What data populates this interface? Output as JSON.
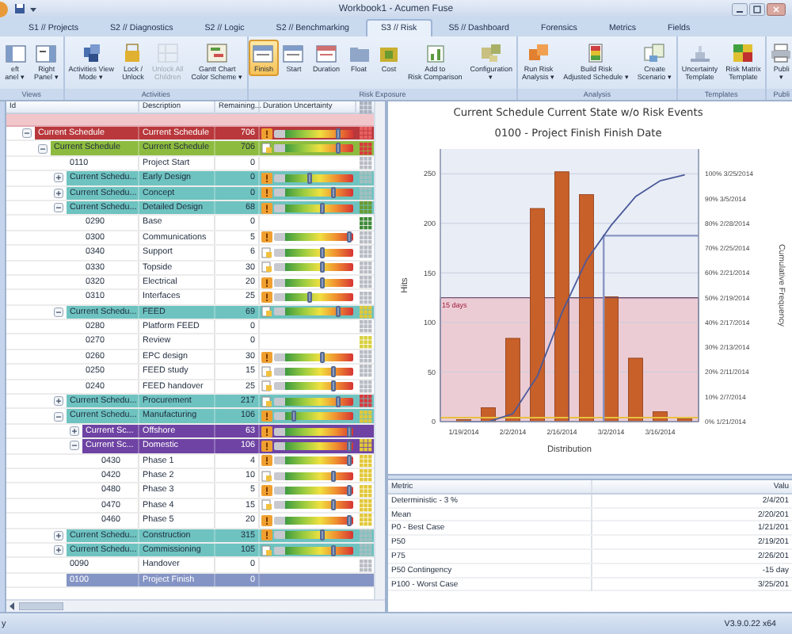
{
  "window": {
    "title": "Workbook1 - Acumen Fuse"
  },
  "tabs": [
    {
      "label": "S1 // Projects",
      "selected": false
    },
    {
      "label": "S2 // Diagnostics",
      "selected": false
    },
    {
      "label": "S2 // Logic",
      "selected": false
    },
    {
      "label": "S2 // Benchmarking",
      "selected": false
    },
    {
      "label": "S3 // Risk",
      "selected": true
    },
    {
      "label": "S5 // Dashboard",
      "selected": false
    },
    {
      "label": "Forensics",
      "selected": false
    },
    {
      "label": "Metrics",
      "selected": false
    },
    {
      "label": "Fields",
      "selected": false
    }
  ],
  "ribbon": {
    "groups": [
      {
        "label": "Views",
        "buttons": [
          {
            "label": "eft\nanel ▾"
          },
          {
            "label": "Right\nPanel ▾"
          }
        ]
      },
      {
        "label": "Activities",
        "buttons": [
          {
            "label": "Activities View\nMode ▾",
            "disabled": false
          },
          {
            "label": "Lock /\nUnlock",
            "disabled": false
          },
          {
            "label": "Unlock All\nChildren",
            "disabled": true
          },
          {
            "label": "Gantt Chart\nColor Scheme ▾",
            "disabled": false
          }
        ]
      },
      {
        "label": "Risk Exposure",
        "buttons": [
          {
            "label": "Finish",
            "selected": true
          },
          {
            "label": "Start",
            "selected": false
          },
          {
            "label": "Duration",
            "selected": false
          },
          {
            "label": "Float",
            "selected": false
          },
          {
            "label": "Cost",
            "selected": false
          },
          {
            "label": "Add to\nRisk Comparison"
          },
          {
            "label": "Configuration\n▾"
          }
        ]
      },
      {
        "label": "Analysis",
        "buttons": [
          {
            "label": "Run Risk\nAnalysis ▾"
          },
          {
            "label": "Build Risk\nAdjusted Schedule ▾"
          },
          {
            "label": "Create\nScenario ▾"
          }
        ]
      },
      {
        "label": "Templates",
        "buttons": [
          {
            "label": "Uncertainty\nTemplate"
          },
          {
            "label": "Risk Matrix\nTemplate"
          }
        ]
      },
      {
        "label": "Publi",
        "buttons": [
          {
            "label": "Publi\n▾"
          }
        ]
      }
    ]
  },
  "tree": {
    "columns": [
      "Id",
      "Description",
      "Remaining...",
      "Duration Uncertainty"
    ],
    "rows": [
      {
        "id": "Current Schedule",
        "description": "Current Schedule",
        "remaining": "706",
        "color": "#b8383c",
        "selected": false,
        "expanded": true,
        "risk_icon": {
          "kind": "alert"
        },
        "level": 0.8,
        "matrix": {
          "color": "#e86060"
        },
        "children": [
          {
            "id": "Current Schedule",
            "description": "Current Schedule",
            "remaining": "706",
            "color": "#8dbb3f",
            "selected": false,
            "expanded": true,
            "risk_icon": {
              "kind": "note"
            },
            "level": 0.8,
            "matrix": {
              "color": "#d9393e"
            },
            "children": [
              {
                "id": "0110",
                "description": "Project Start",
                "remaining": "0",
                "selected": false,
                "matrix": {
                  "color": "#b8bcc4"
                }
              },
              {
                "id": "Current Schedu...",
                "description": "Early Design",
                "remaining": "0",
                "color": "#6ec3c0",
                "selected": false,
                "expanded": false,
                "risk_icon": {
                  "kind": "alert"
                },
                "level": 0.45,
                "matrix": {
                  "color": "#a3bfc0"
                }
              },
              {
                "id": "Current Schedu...",
                "description": "Concept",
                "remaining": "0",
                "color": "#6ec3c0",
                "selected": false,
                "expanded": false,
                "risk_icon": {
                  "kind": "alert"
                },
                "level": 0.75,
                "matrix": {
                  "color": "#a3bfc0"
                }
              },
              {
                "id": "Current Schedu...",
                "description": "Detailed Design",
                "remaining": "68",
                "color": "#6ec3c0",
                "selected": false,
                "expanded": true,
                "risk_icon": {
                  "kind": "alert"
                },
                "level": 0.6,
                "matrix": {
                  "color": "#6a9a30"
                },
                "children": [
                  {
                    "id": "0290",
                    "description": "Base",
                    "remaining": "0",
                    "selected": false,
                    "matrix": {
                      "color": "#3f8a3a"
                    }
                  },
                  {
                    "id": "0300",
                    "description": "Communications",
                    "remaining": "5",
                    "selected": false,
                    "risk_icon": {
                      "kind": "alert"
                    },
                    "level": 0.95,
                    "matrix": {
                      "color": "#b8bcc4"
                    }
                  },
                  {
                    "id": "0340",
                    "description": "Support",
                    "remaining": "6",
                    "selected": false,
                    "risk_icon": {
                      "kind": "note"
                    },
                    "level": 0.6,
                    "matrix": {
                      "color": "#b8bcc4"
                    }
                  },
                  {
                    "id": "0330",
                    "description": "Topside",
                    "remaining": "30",
                    "selected": false,
                    "risk_icon": {
                      "kind": "note"
                    },
                    "level": 0.6,
                    "matrix": {
                      "color": "#b8bcc4"
                    }
                  },
                  {
                    "id": "0320",
                    "description": "Electrical",
                    "remaining": "20",
                    "selected": false,
                    "risk_icon": {
                      "kind": "alert"
                    },
                    "level": 0.6,
                    "matrix": {
                      "color": "#b8bcc4"
                    }
                  },
                  {
                    "id": "0310",
                    "description": "Interfaces",
                    "remaining": "25",
                    "selected": false,
                    "risk_icon": {
                      "kind": "alert"
                    },
                    "level": 0.45,
                    "matrix": {
                      "color": "#b8bcc4"
                    }
                  }
                ]
              },
              {
                "id": "Current Schedu...",
                "description": "FEED",
                "remaining": "69",
                "color": "#6ec3c0",
                "selected": false,
                "expanded": true,
                "risk_icon": {
                  "kind": "note"
                },
                "level": 0.8,
                "matrix": {
                  "color": "#e2c83a"
                },
                "children": [
                  {
                    "id": "0280",
                    "description": "Platform FEED",
                    "remaining": "0",
                    "selected": false,
                    "matrix": {
                      "color": "#b8bcc4"
                    }
                  },
                  {
                    "id": "0270",
                    "description": "Review",
                    "remaining": "0",
                    "selected": false,
                    "matrix": {
                      "color": "#d8d040"
                    }
                  },
                  {
                    "id": "0260",
                    "description": "EPC design",
                    "remaining": "30",
                    "selected": false,
                    "risk_icon": {
                      "kind": "alert"
                    },
                    "level": 0.6,
                    "matrix": {
                      "color": "#b8bcc4"
                    }
                  },
                  {
                    "id": "0250",
                    "description": "FEED study",
                    "remaining": "15",
                    "selected": false,
                    "risk_icon": {
                      "kind": "note"
                    },
                    "level": 0.75,
                    "matrix": {
                      "color": "#b8bcc4"
                    }
                  },
                  {
                    "id": "0240",
                    "description": "FEED handover",
                    "remaining": "25",
                    "selected": false,
                    "risk_icon": {
                      "kind": "note"
                    },
                    "level": 0.75,
                    "matrix": {
                      "color": "#b8bcc4"
                    }
                  }
                ]
              },
              {
                "id": "Current Schedu...",
                "description": "Procurement",
                "remaining": "217",
                "color": "#6ec3c0",
                "selected": false,
                "expanded": false,
                "risk_icon": {
                  "kind": "note"
                },
                "level": 0.8,
                "matrix": {
                  "color": "#d9393e"
                }
              },
              {
                "id": "Current Schedu...",
                "description": "Manufacturing",
                "remaining": "106",
                "color": "#6ec3c0",
                "selected": false,
                "expanded": true,
                "risk_icon": {
                  "kind": "alert"
                },
                "level": 0.25,
                "matrix": {
                  "color": "#e2c83a"
                },
                "children": [
                  {
                    "id": "Current Sc...",
                    "description": "Offshore",
                    "remaining": "63",
                    "color": "#6e43a3",
                    "selected": false,
                    "expanded": false,
                    "risk_icon": {
                      "kind": "alert"
                    },
                    "level": 0.95
                  },
                  {
                    "id": "Current Sc...",
                    "description": "Domestic",
                    "remaining": "106",
                    "color": "#6e43a3",
                    "selected": false,
                    "expanded": true,
                    "risk_icon": {
                      "kind": "alert"
                    },
                    "level": 0.95,
                    "matrix": {
                      "color": "#e2c83a"
                    },
                    "children": [
                      {
                        "id": "0430",
                        "description": "Phase 1",
                        "remaining": "4",
                        "selected": false,
                        "risk_icon": {
                          "kind": "alert"
                        },
                        "level": 0.95,
                        "matrix": {
                          "color": "#e2c83a"
                        }
                      },
                      {
                        "id": "0420",
                        "description": "Phase 2",
                        "remaining": "10",
                        "selected": false,
                        "risk_icon": {
                          "kind": "note"
                        },
                        "level": 0.75,
                        "matrix": {
                          "color": "#e2c83a"
                        }
                      },
                      {
                        "id": "0480",
                        "description": "Phase 3",
                        "remaining": "5",
                        "selected": false,
                        "risk_icon": {
                          "kind": "alert"
                        },
                        "level": 0.95,
                        "matrix": {
                          "color": "#e2c83a"
                        }
                      },
                      {
                        "id": "0470",
                        "description": "Phase 4",
                        "remaining": "15",
                        "selected": false,
                        "risk_icon": {
                          "kind": "note"
                        },
                        "level": 0.75,
                        "matrix": {
                          "color": "#e2c83a"
                        }
                      },
                      {
                        "id": "0460",
                        "description": "Phase 5",
                        "remaining": "20",
                        "selected": false,
                        "risk_icon": {
                          "kind": "alert"
                        },
                        "level": 0.95,
                        "matrix": {
                          "color": "#e2c83a"
                        }
                      }
                    ]
                  }
                ]
              },
              {
                "id": "Current Schedu...",
                "description": "Construction",
                "remaining": "315",
                "color": "#6ec3c0",
                "selected": false,
                "expanded": false,
                "risk_icon": {
                  "kind": "alert"
                },
                "level": 0.6,
                "matrix": {
                  "color": "#a3bfc0"
                }
              },
              {
                "id": "Current Schedu...",
                "description": "Commissioning",
                "remaining": "105",
                "color": "#6ec3c0",
                "selected": false,
                "expanded": false,
                "risk_icon": {
                  "kind": "note"
                },
                "level": 0.75,
                "matrix": {
                  "color": "#a3bfc0"
                }
              },
              {
                "id": "0090",
                "description": "Handover",
                "remaining": "0",
                "selected": false,
                "matrix": {
                  "color": "#b8bcc4"
                }
              },
              {
                "id": "0100",
                "description": "Project Finish",
                "remaining": "0",
                "selected": true
              }
            ]
          }
        ]
      }
    ]
  },
  "chart_panel": {
    "title": "Current Schedule Current State w/o Risk Events",
    "subtitle": "0100 - Project Finish Finish Date",
    "right_axis": {
      "labels": [
        "100% 3/25/2014",
        "90% 3/5/2014",
        "80% 2/28/2014",
        "70% 2/25/2014",
        "60% 2/21/2014",
        "50% 2/19/2014",
        "40% 2/17/2014",
        "30% 2/13/2014",
        "20% 2/11/2014",
        "10% 2/7/2014",
        "0% 1/21/2014"
      ]
    },
    "chart_data": {
      "type": "bar",
      "xlabel": "Distribution",
      "ylabel": "Hits",
      "categories": [
        "1/19/2014",
        null,
        "2/2/2014",
        null,
        "2/16/2014",
        null,
        "3/2/2014",
        null,
        "3/16/2014",
        null
      ],
      "series": [
        {
          "color": "#c8602a",
          "values": [
            2,
            14,
            84,
            215,
            252,
            229,
            126,
            64,
            10,
            3
          ]
        },
        {
          "name": "Cumulative Frequency",
          "type": "line",
          "color": "#4a5a9a",
          "values": [
            0,
            0,
            8,
            46,
            110,
            163,
            198,
            227,
            243,
            249
          ]
        }
      ],
      "bands": [
        {
          "axis": "y",
          "from": 0,
          "to": 125,
          "color": "#ecccd4"
        }
      ],
      "ylim": [
        0,
        275
      ],
      "yticks": [
        0,
        50,
        100,
        150,
        200,
        250
      ],
      "ref_lines": [
        {
          "axis": "y",
          "value": 125
        },
        {
          "axis": "y",
          "value": 187.5
        }
      ],
      "annotations": [
        {
          "text": "15 days"
        }
      ]
    }
  },
  "metrics": {
    "columns": [
      "Metric",
      "Valu"
    ],
    "rows": [
      [
        "Deterministic - 3 %",
        "2/4/201"
      ],
      [
        "Mean",
        "2/20/201"
      ],
      [
        "P0 - Best Case",
        "1/21/201"
      ],
      [
        "P50",
        "2/19/201"
      ],
      [
        "P75",
        "2/26/201"
      ],
      [
        "P50 Contingency",
        "-15 day"
      ],
      [
        "P100 - Worst Case",
        "3/25/201"
      ]
    ]
  },
  "status_bar": {
    "left": "y",
    "version": "V3.9.0.22 x64"
  }
}
